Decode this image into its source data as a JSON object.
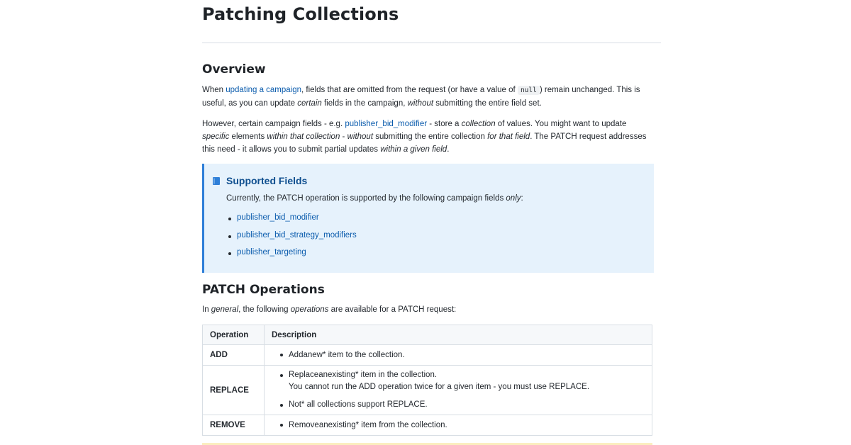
{
  "page": {
    "title": "Patching Collections"
  },
  "overview": {
    "heading": "Overview",
    "p1": {
      "t1": "When ",
      "link": "updating a campaign",
      "t2": ", fields that are omitted from the request (or have a value of ",
      "code": "null",
      "t3": ") remain unchanged. This is useful, as you can update ",
      "em1": "certain",
      "t4": " fields in the campaign, ",
      "em2": "without",
      "t5": " submitting the entire field set."
    },
    "p2": {
      "t1": "However, certain campaign fields - e.g. ",
      "link": "publisher_bid_modifier",
      "t2": " - store a ",
      "em1": "collection",
      "t3": " of values. You might want to update ",
      "em2": "specific",
      "t4": " elements ",
      "em3": "within that collection",
      "t5": " - ",
      "em4": "without",
      "t6": " submitting the entire collection ",
      "em5": "for that field",
      "t7": ". The PATCH request addresses this need - it allows you to submit partial updates ",
      "em6": "within a given field",
      "t8": "."
    }
  },
  "callout": {
    "icon": "book-icon",
    "title": "Supported Fields",
    "text_prefix": "Currently, the PATCH operation is supported by the following campaign fields ",
    "text_em": "only",
    "text_suffix": ":",
    "items": [
      "publisher_bid_modifier",
      "publisher_bid_strategy_modifiers",
      "publisher_targeting"
    ]
  },
  "operations": {
    "heading": "PATCH Operations",
    "intro": {
      "t1": "In ",
      "em1": "general",
      "t2": ", the following ",
      "em2": "operations",
      "t3": " are available for a PATCH request:"
    },
    "table": {
      "headers": [
        "Operation",
        "Description"
      ],
      "rows": [
        {
          "op": "ADD",
          "items": [
            "Addanew* item to the collection."
          ]
        },
        {
          "op": "REPLACE",
          "items": [
            "Replaceanexisting* item in the collection.",
            "You cannot run the ADD operation twice for a given item - you must use REPLACE.",
            "Not* all collections support REPLACE."
          ]
        },
        {
          "op": "REMOVE",
          "items": [
            "Removeanexisting* item from the collection."
          ]
        }
      ]
    }
  },
  "colors": {
    "link": "#0b5cad",
    "callout_bg": "#e6f2fc",
    "callout_border": "#2e7fd8",
    "callout_title": "#0f4f8f"
  }
}
